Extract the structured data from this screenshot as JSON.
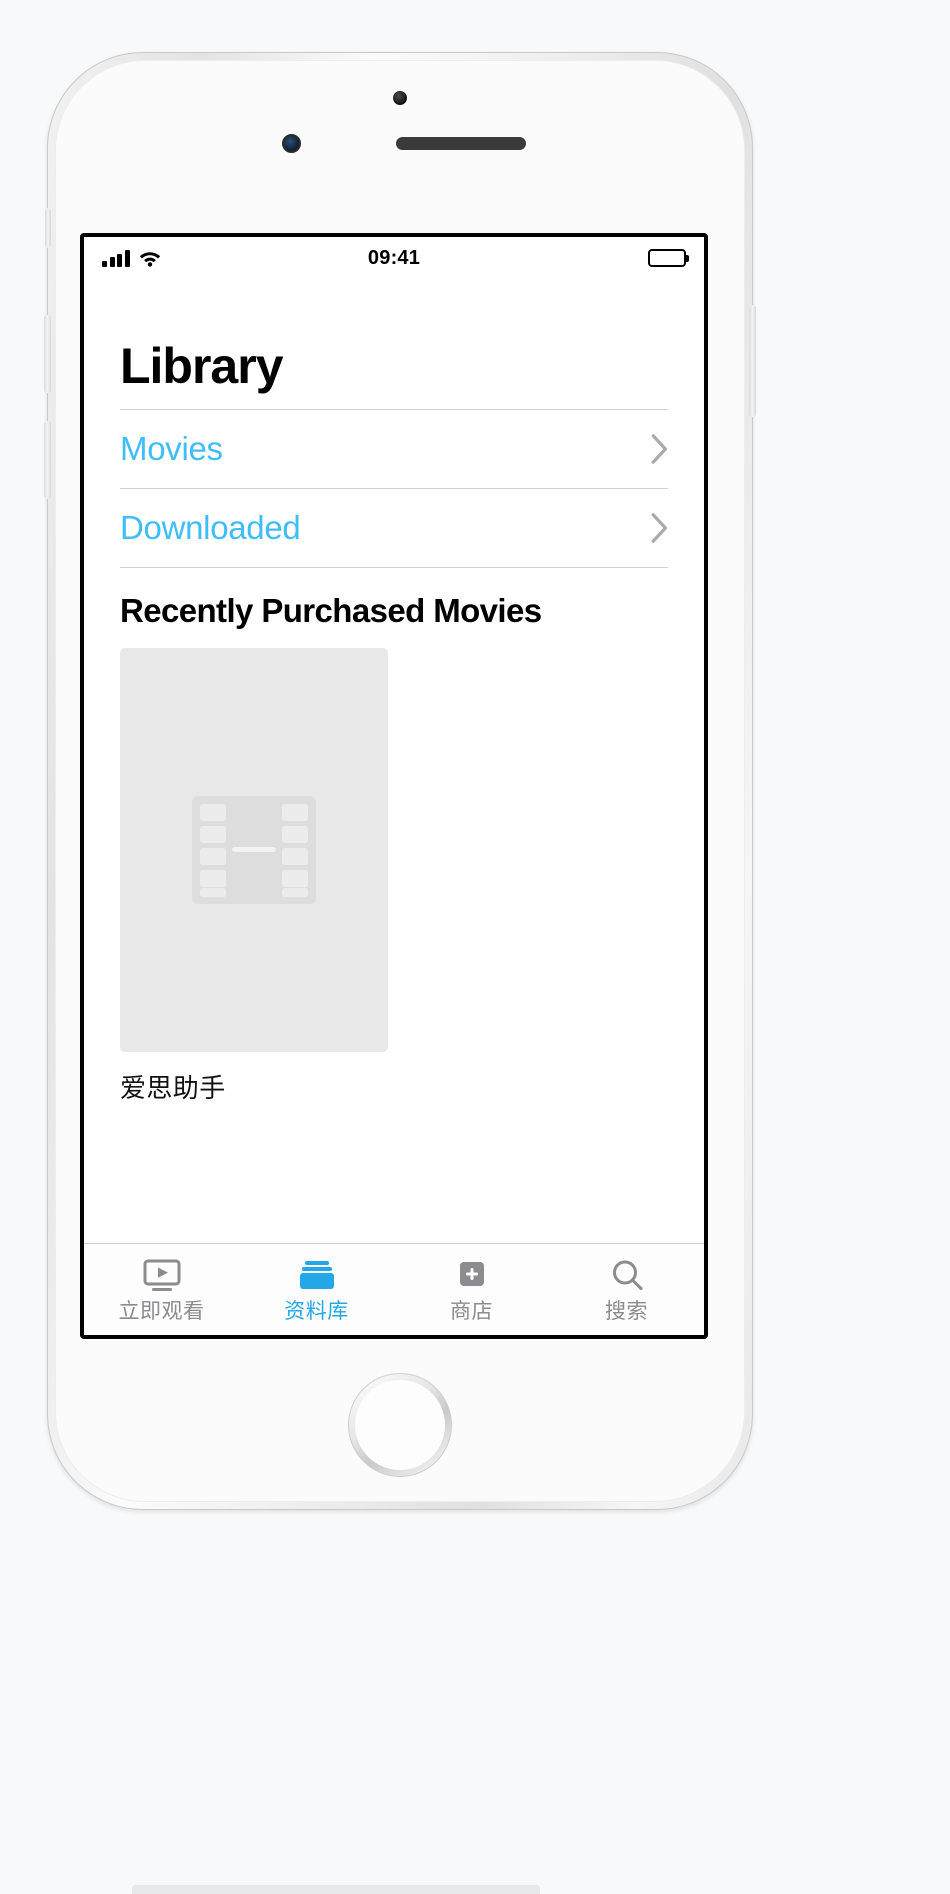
{
  "device": {
    "name": "iphone-silver",
    "home_button": "home-button"
  },
  "status_bar": {
    "signal_icon": "cellular-signal-icon",
    "signal_bars": 4,
    "wifi_icon": "wifi-icon",
    "time": "09:41",
    "battery_icon": "battery-full-icon",
    "battery_level": 100
  },
  "screen": {
    "page_title": "Library",
    "list_rows": [
      {
        "label": "Movies",
        "accessory_icon": "chevron-right-icon"
      },
      {
        "label": "Downloaded",
        "accessory_icon": "chevron-right-icon"
      }
    ],
    "section": {
      "heading": "Recently Purchased Movies",
      "items": [
        {
          "title": "爱思助手",
          "artwork_icon": "film-strip-placeholder-icon"
        }
      ]
    }
  },
  "tab_bar": {
    "active_index": 1,
    "tabs": [
      {
        "label": "立即观看",
        "icon": "play-rectangle-icon"
      },
      {
        "label": "资料库",
        "icon": "library-stack-icon"
      },
      {
        "label": "商店",
        "icon": "plus-square-icon"
      },
      {
        "label": "搜索",
        "icon": "magnifier-icon"
      }
    ]
  },
  "colors": {
    "accent_blue": "#3fbdf6",
    "tab_active": "#22a7e8",
    "tab_inactive": "#8b8b90",
    "placeholder_bg": "#e8e8e8",
    "separator": "#d2d2d4"
  }
}
